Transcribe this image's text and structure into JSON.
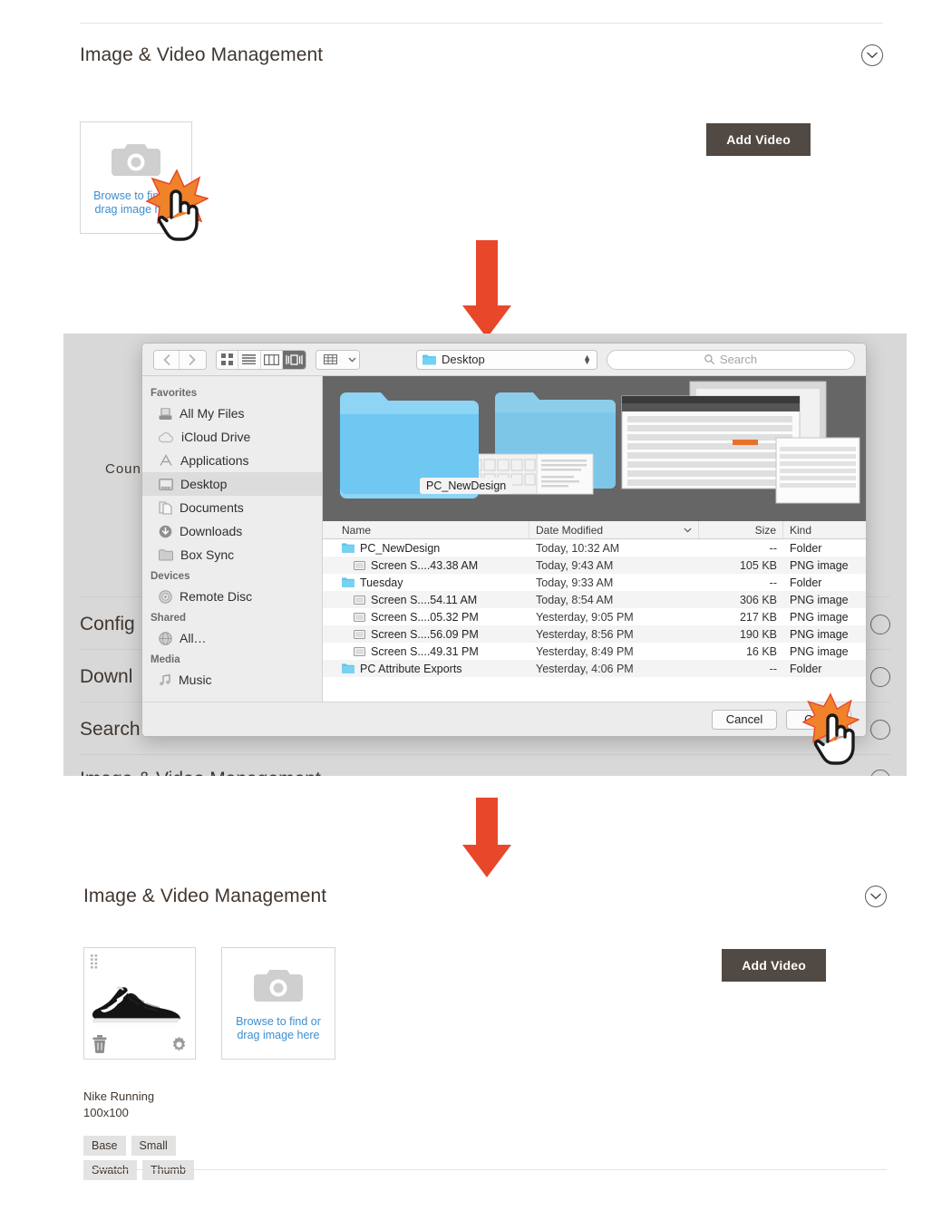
{
  "steps": {
    "top": {
      "section_title": "Image & Video Management",
      "add_video_label": "Add Video",
      "upload_label_line1": "Browse to find or",
      "upload_label_line2": "drag image here"
    },
    "bottom": {
      "section_title": "Image & Video Management",
      "add_video_label": "Add Video",
      "upload_label_line1": "Browse to find or",
      "upload_label_line2": "drag image here",
      "image_name": "Nike Running",
      "image_size": "100x100",
      "roles": [
        "Base",
        "Small",
        "Swatch",
        "Thumb"
      ]
    }
  },
  "dimmed_background": {
    "partial_labels": [
      "S",
      "Coun",
      "Config",
      "Downl",
      "Search",
      "Image & Video Management"
    ]
  },
  "file_dialog": {
    "path_label": "Desktop",
    "search_placeholder": "Search",
    "preview_folder_label": "PC_NewDesign",
    "columns": [
      "Name",
      "Date Modified",
      "Size",
      "Kind"
    ],
    "sidebar": [
      {
        "group": "Favorites",
        "items": [
          {
            "label": "All My Files",
            "icon": "all-my-files-icon"
          },
          {
            "label": "iCloud Drive",
            "icon": "icloud-icon"
          },
          {
            "label": "Applications",
            "icon": "applications-icon"
          },
          {
            "label": "Desktop",
            "icon": "desktop-icon",
            "selected": true
          },
          {
            "label": "Documents",
            "icon": "documents-icon"
          },
          {
            "label": "Downloads",
            "icon": "downloads-icon"
          },
          {
            "label": "Box Sync",
            "icon": "folder-icon"
          }
        ]
      },
      {
        "group": "Devices",
        "items": [
          {
            "label": "Remote Disc",
            "icon": "disc-icon"
          }
        ]
      },
      {
        "group": "Shared",
        "items": [
          {
            "label": "All…",
            "icon": "network-globe-icon"
          }
        ]
      },
      {
        "group": "Media",
        "items": [
          {
            "label": "Music",
            "icon": "music-icon"
          }
        ]
      }
    ],
    "rows": [
      {
        "name": "PC_NewDesign",
        "date": "Today, 10:32 AM",
        "size": "--",
        "kind": "Folder",
        "type": "folder"
      },
      {
        "name": "Screen S....43.38 AM",
        "date": "Today, 9:43 AM",
        "size": "105 KB",
        "kind": "PNG image",
        "type": "file"
      },
      {
        "name": "Tuesday",
        "date": "Today, 9:33 AM",
        "size": "--",
        "kind": "Folder",
        "type": "folder"
      },
      {
        "name": "Screen S....54.11 AM",
        "date": "Today, 8:54 AM",
        "size": "306 KB",
        "kind": "PNG image",
        "type": "file"
      },
      {
        "name": "Screen S....05.32 PM",
        "date": "Yesterday, 9:05 PM",
        "size": "217 KB",
        "kind": "PNG image",
        "type": "file"
      },
      {
        "name": "Screen S....56.09 PM",
        "date": "Yesterday, 8:56 PM",
        "size": "190 KB",
        "kind": "PNG image",
        "type": "file"
      },
      {
        "name": "Screen S....49.31 PM",
        "date": "Yesterday, 8:49 PM",
        "size": "16 KB",
        "kind": "PNG image",
        "type": "file"
      },
      {
        "name": "PC Attribute Exports",
        "date": "Yesterday, 4:06 PM",
        "size": "--",
        "kind": "Folder",
        "type": "folder"
      }
    ],
    "cancel_label": "Cancel",
    "open_label": "Open"
  },
  "colors": {
    "arrow": "#e8472a",
    "burst": "#f0822a",
    "link": "#3d8ecf",
    "button": "#514943",
    "chip": "#e3e3e3"
  }
}
